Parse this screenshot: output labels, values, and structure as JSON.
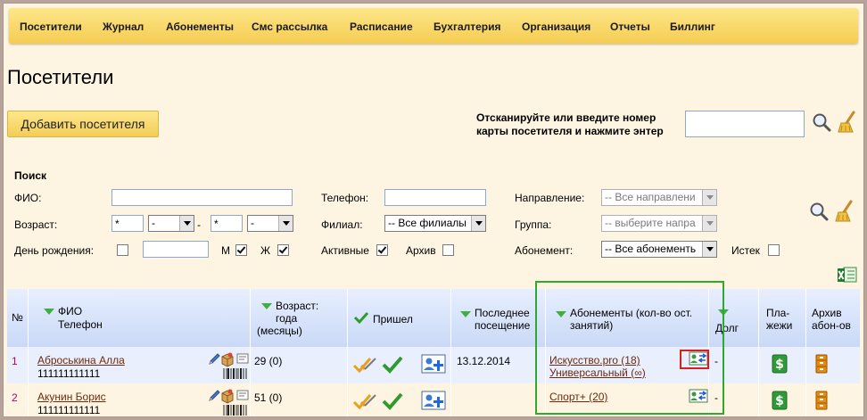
{
  "nav": [
    "Посетители",
    "Журнал",
    "Абонементы",
    "Смс рассылка",
    "Расписание",
    "Бухгалтерия",
    "Организация",
    "Отчеты",
    "Биллинг"
  ],
  "page_title": "Посетители",
  "add_button": "Добавить посетителя",
  "scan": {
    "label": "Отсканируйте или введите номер карты посетителя и нажмите энтер",
    "value": ""
  },
  "search": {
    "title": "Поиск",
    "fio_label": "ФИО:",
    "age_label": "Возраст:",
    "age_from": "*",
    "age_to": "*",
    "age_from_unit": "-",
    "age_to_unit": "-",
    "age_dash": "-",
    "birthday_label": "День рождения:",
    "m_label": "М",
    "f_label": "Ж",
    "phone_label": "Телефон:",
    "branch_label": "Филиал:",
    "branch_value": "-- Все филиалы",
    "active_label": "Активные",
    "archive_label": "Архив",
    "direction_label": "Направление:",
    "direction_value": "-- Все направлени",
    "group_label": "Группа:",
    "group_value": "-- выберите напра",
    "subscription_label": "Абонемент:",
    "subscription_value": "-- Все абонементь",
    "expired_label": "Истек"
  },
  "table": {
    "headers": {
      "num": "№",
      "fio": "ФИО",
      "phone": "Телефон",
      "age": "Возраст:",
      "age2": "года",
      "age3": "(месяцы)",
      "came": "Пришел",
      "last_visit": "Последнее посещение",
      "subs": "Абонементы (кол-во ост. занятий)",
      "debt": "Долг",
      "payments": "Пла-жежи",
      "payments1": "Пла-",
      "payments2": "жежи",
      "archive1": "Архив",
      "archive2": "абон-ов"
    },
    "rows": [
      {
        "num": "1",
        "name": "Аброськина Алла",
        "phone": "111111111111",
        "age": "29 (0)",
        "last_visit": "13.12.2014",
        "sub1": "Искусство.pro (18)",
        "sub2": "Универсальный (∞)",
        "debt": "-"
      },
      {
        "num": "2",
        "name": "Акунин Борис",
        "phone": "111111111111",
        "age": "51 (0)",
        "last_visit": "",
        "sub1": "Спорт+ (20)",
        "sub2": "",
        "debt": "-"
      }
    ]
  },
  "colors": {
    "accent_green": "#2fa82f",
    "highlight_red": "#d81e1e",
    "nav_yellow": "#f5cc52",
    "header_blue": "#c9d9f6",
    "link": "#6b2a10"
  }
}
